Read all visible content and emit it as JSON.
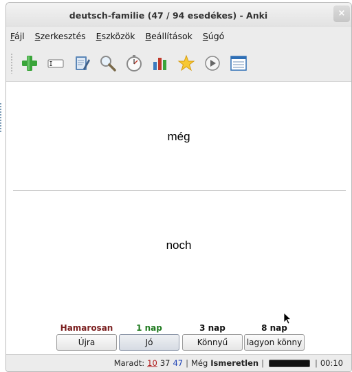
{
  "window": {
    "title": "deutsch-familie (47 / 94 esedékes) - Anki",
    "close_glyph": "×"
  },
  "menu": {
    "items": [
      "Fájl",
      "Szerkesztés",
      "Eszközök",
      "Beállítások",
      "Súgó"
    ]
  },
  "toolbar": {
    "buttons": [
      "add-icon",
      "edit-field-icon",
      "notepad-icon",
      "search-icon",
      "timer-icon",
      "stats-icon",
      "star-icon",
      "play-icon",
      "card-list-icon"
    ]
  },
  "card": {
    "front": "még",
    "back": "noch"
  },
  "answers": [
    {
      "interval": "Hamarosan",
      "label": "Újra",
      "color": "#7a1e1e"
    },
    {
      "interval": "1 nap",
      "label": "Jó",
      "color": "#1f7a1f"
    },
    {
      "interval": "3 nap",
      "label": "Könnyű",
      "color": "#111111"
    },
    {
      "interval": "8 nap",
      "label": "lagyon könny",
      "color": "#111111"
    }
  ],
  "status": {
    "remaining_label": "Maradt:",
    "count_red": "10",
    "count_black": "37",
    "count_blue": "47",
    "card_type_prefix": "Még",
    "card_type": "Ismeretlen",
    "progress": 1.0,
    "time": "00:10"
  }
}
